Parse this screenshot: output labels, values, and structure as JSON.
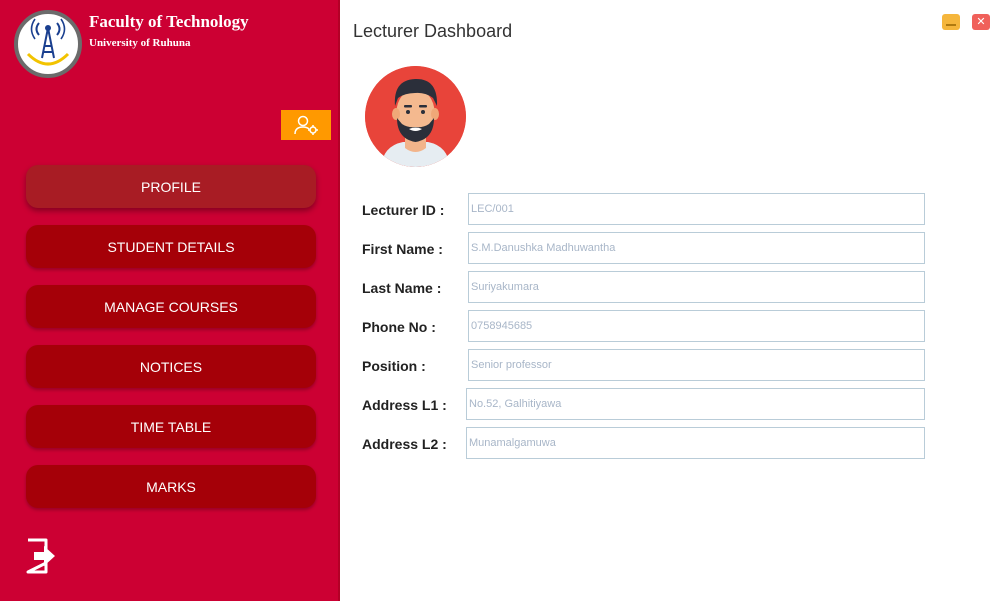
{
  "sidebar": {
    "faculty_title": "Faculty of Technology",
    "university": "University of Ruhuna",
    "logo_text": "Faculty of Technology",
    "nav": [
      {
        "label": "PROFILE"
      },
      {
        "label": "STUDENT DETAILS"
      },
      {
        "label": "MANAGE COURSES"
      },
      {
        "label": "NOTICES"
      },
      {
        "label": "TIME TABLE"
      },
      {
        "label": "MARKS"
      }
    ]
  },
  "header": {
    "title": "Lecturer Dashboard"
  },
  "window_controls": {
    "close_glyph": "✕"
  },
  "profile": {
    "fields": [
      {
        "label": "Lecturer ID :",
        "value": "LEC/001"
      },
      {
        "label": "First Name :",
        "value": "S.M.Danushka Madhuwantha"
      },
      {
        "label": "Last Name :",
        "value": "Suriyakumara"
      },
      {
        "label": "Phone No :",
        "value": "0758945685"
      },
      {
        "label": "Position :",
        "value": "Senior professor"
      },
      {
        "label": "Address L1 :",
        "value": "No.52, Galhitiyawa"
      },
      {
        "label": "Address L2 :",
        "value": "Munamalgamuwa"
      }
    ]
  },
  "colors": {
    "sidebar": "#cc0033",
    "nav_button": "#a50008",
    "settings_button": "#ff9900",
    "minimize": "#f5b63c",
    "close": "#f0605a"
  },
  "icons": {
    "logo": "faculty-logo",
    "settings": "user-settings-icon",
    "logout": "logout-icon",
    "avatar": "lecturer-avatar"
  }
}
